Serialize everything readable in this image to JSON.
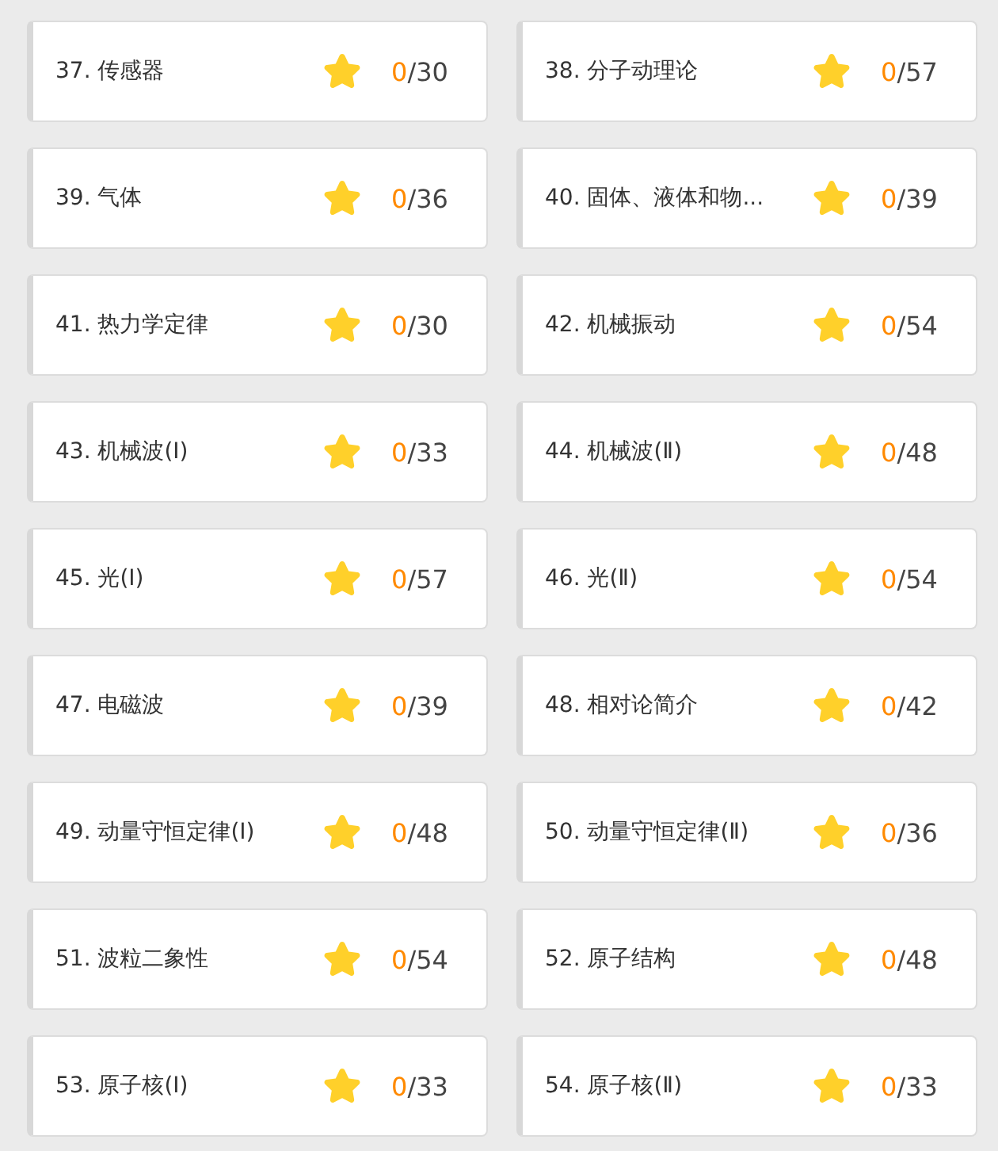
{
  "chapters": [
    {
      "title": "37. 传感器",
      "done": "0",
      "total": "/30"
    },
    {
      "title": "38. 分子动理论",
      "done": "0",
      "total": "/57"
    },
    {
      "title": "39. 气体",
      "done": "0",
      "total": "/36"
    },
    {
      "title": "40. 固体、液体和物...",
      "done": "0",
      "total": "/39"
    },
    {
      "title": "41. 热力学定律",
      "done": "0",
      "total": "/30"
    },
    {
      "title": "42. 机械振动",
      "done": "0",
      "total": "/54"
    },
    {
      "title": "43. 机械波(Ⅰ)",
      "done": "0",
      "total": "/33"
    },
    {
      "title": "44. 机械波(Ⅱ)",
      "done": "0",
      "total": "/48"
    },
    {
      "title": "45. 光(Ⅰ)",
      "done": "0",
      "total": "/57"
    },
    {
      "title": "46. 光(Ⅱ)",
      "done": "0",
      "total": "/54"
    },
    {
      "title": "47. 电磁波",
      "done": "0",
      "total": "/39"
    },
    {
      "title": "48. 相对论简介",
      "done": "0",
      "total": "/42"
    },
    {
      "title": "49. 动量守恒定律(Ⅰ)",
      "done": "0",
      "total": "/48"
    },
    {
      "title": "50. 动量守恒定律(Ⅱ)",
      "done": "0",
      "total": "/36"
    },
    {
      "title": "51. 波粒二象性",
      "done": "0",
      "total": "/54"
    },
    {
      "title": "52. 原子结构",
      "done": "0",
      "total": "/48"
    },
    {
      "title": "53. 原子核(Ⅰ)",
      "done": "0",
      "total": "/33"
    },
    {
      "title": "54. 原子核(Ⅱ)",
      "done": "0",
      "total": "/33"
    }
  ]
}
